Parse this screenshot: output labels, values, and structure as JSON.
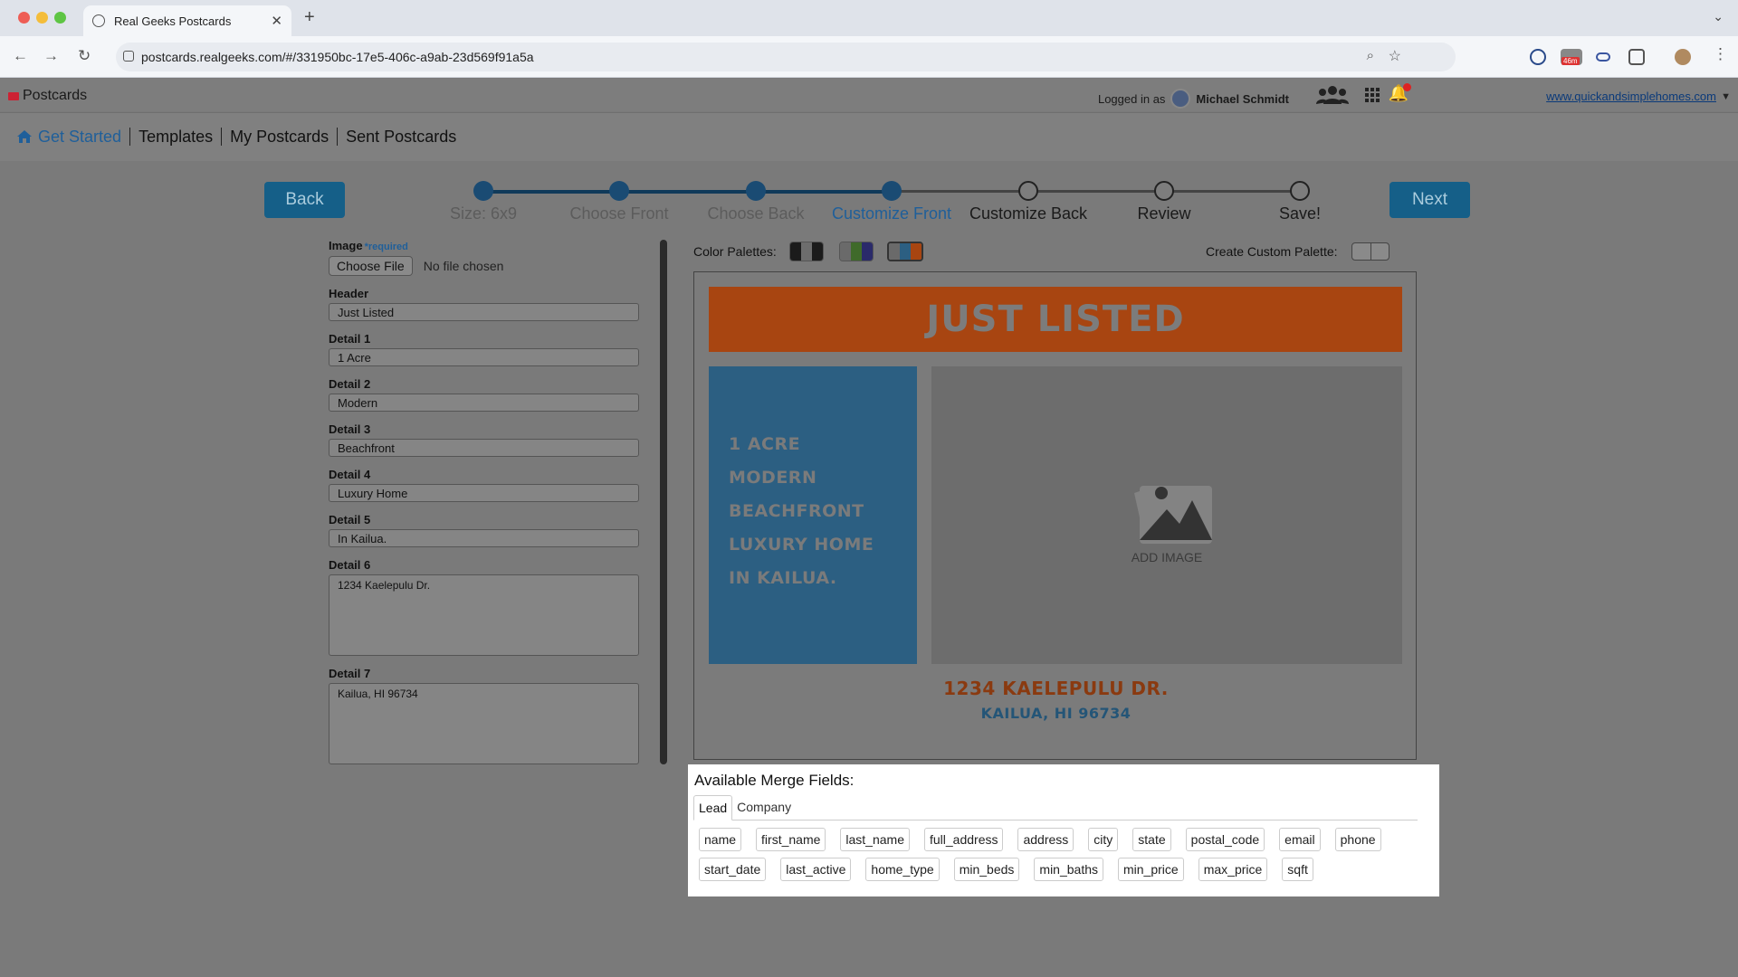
{
  "browser": {
    "tab_title": "Real Geeks Postcards",
    "url": "postcards.realgeeks.com/#/331950bc-17e5-406c-a9ab-23d569f91a5a",
    "ext_badge": "46m"
  },
  "app": {
    "brand": "Postcards",
    "logged_in_prefix": "Logged in as",
    "user_name": "Michael Schmidt",
    "notification_count": "6",
    "site_link": "www.quickandsimplehomes.com"
  },
  "menu": {
    "items": [
      "Get Started",
      "Templates",
      "My Postcards",
      "Sent Postcards"
    ]
  },
  "wizard": {
    "back_label": "Back",
    "next_label": "Next",
    "steps": [
      "Size: 6x9",
      "Choose Front",
      "Choose Back",
      "Customize Front",
      "Customize Back",
      "Review",
      "Save!"
    ]
  },
  "form": {
    "image_label": "Image",
    "required_label": "*required",
    "choose_file_label": "Choose File",
    "no_file_text": "No file chosen",
    "fields": [
      {
        "label": "Header",
        "value": "Just Listed"
      },
      {
        "label": "Detail 1",
        "value": "1 Acre"
      },
      {
        "label": "Detail 2",
        "value": "Modern"
      },
      {
        "label": "Detail 3",
        "value": "Beachfront"
      },
      {
        "label": "Detail 4",
        "value": "Luxury Home"
      },
      {
        "label": "Detail 5",
        "value": "In Kailua."
      },
      {
        "label": "Detail 6",
        "value": "1234 Kaelepulu Dr."
      },
      {
        "label": "Detail 7",
        "value": "Kailua, HI 96734"
      }
    ]
  },
  "palette": {
    "label": "Color Palettes:",
    "custom_label": "Create Custom Palette:",
    "swatches": [
      [
        "#1b1b1b",
        "#6d6d6d",
        "#1b1b1b"
      ],
      [
        "#6a6a6a",
        "#3f6a2a",
        "#2a2a6a"
      ],
      [
        "#6a6a6a",
        "#2c5f82",
        "#a84511"
      ]
    ]
  },
  "postcard": {
    "header": "JUST LISTED",
    "details": [
      "1 ACRE",
      "MODERN",
      "BEACHFRONT",
      "LUXURY HOME",
      "IN KAILUA."
    ],
    "add_image": "ADD IMAGE",
    "address1": "1234 KAELEPULU DR.",
    "address2": "KAILUA, HI 96734",
    "colors": {
      "header": "#a84511",
      "details": "#2c5f82"
    }
  },
  "merge": {
    "title": "Available Merge Fields:",
    "tabs": [
      "Lead",
      "Company"
    ],
    "fields": [
      "name",
      "first_name",
      "last_name",
      "full_address",
      "address",
      "city",
      "state",
      "postal_code",
      "email",
      "phone",
      "start_date",
      "last_active",
      "home_type",
      "min_beds",
      "min_baths",
      "min_price",
      "max_price",
      "sqft"
    ]
  }
}
